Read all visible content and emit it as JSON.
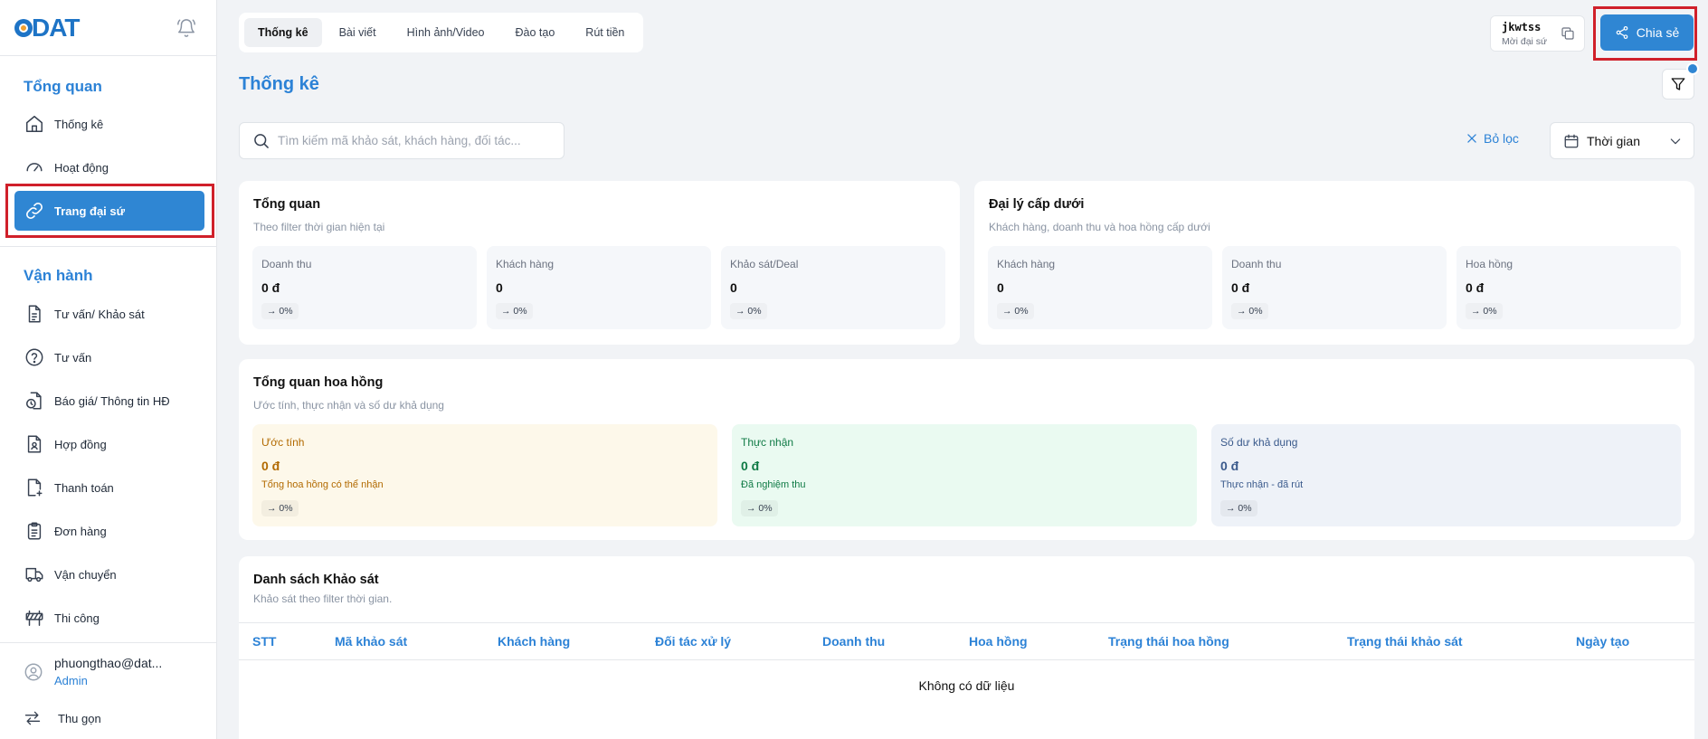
{
  "brand": {
    "logo": "DAT"
  },
  "sidebar": {
    "section_overview": "Tổng quan",
    "overview_items": [
      {
        "label": "Thống kê",
        "icon": "home-icon"
      },
      {
        "label": "Hoạt động",
        "icon": "gauge-icon"
      },
      {
        "label": "Trang đại sứ",
        "icon": "link-icon",
        "active": true
      }
    ],
    "section_operations": "Vận hành",
    "operation_items": [
      {
        "label": "Tư vấn/ Khảo sát",
        "icon": "document-icon"
      },
      {
        "label": "Tư vấn",
        "icon": "help-circle-icon"
      },
      {
        "label": "Báo giá/ Thông tin HĐ",
        "icon": "file-clock-icon"
      },
      {
        "label": "Hợp đồng",
        "icon": "contract-icon"
      },
      {
        "label": "Thanh toán",
        "icon": "file-plus-icon"
      },
      {
        "label": "Đơn hàng",
        "icon": "clipboard-icon"
      },
      {
        "label": "Vận chuyển",
        "icon": "truck-icon"
      },
      {
        "label": "Thi công",
        "icon": "construction-icon"
      }
    ],
    "user": {
      "email": "phuongthao@dat...",
      "role": "Admin"
    },
    "collapse_label": "Thu gọn"
  },
  "tabs": [
    "Thống kê",
    "Bài viết",
    "Hình ảnh/Video",
    "Đào tạo",
    "Rút tiền"
  ],
  "page_title": "Thống kê",
  "invite": {
    "code": "jkwtss",
    "subtitle": "Mời đại sứ"
  },
  "share_label": "Chia sẻ",
  "search": {
    "placeholder": "Tìm kiếm mã khảo sát, khách hàng, đối tác..."
  },
  "clear_filter_label": "Bỏ lọc",
  "time_select": {
    "value": "Thời gian"
  },
  "overview": {
    "title": "Tổng quan",
    "subtitle": "Theo filter thời gian hiện tại",
    "stats": [
      {
        "label": "Doanh thu",
        "value": "0 đ",
        "change": "→ 0%"
      },
      {
        "label": "Khách hàng",
        "value": "0",
        "change": "→ 0%"
      },
      {
        "label": "Khảo sát/Deal",
        "value": "0",
        "change": "→ 0%"
      }
    ]
  },
  "sub_agents": {
    "title": "Đại lý cấp dưới",
    "subtitle": "Khách hàng, doanh thu và hoa hồng cấp dưới",
    "stats": [
      {
        "label": "Khách hàng",
        "value": "0",
        "change": "→ 0%"
      },
      {
        "label": "Doanh thu",
        "value": "0 đ",
        "change": "→ 0%"
      },
      {
        "label": "Hoa hồng",
        "value": "0 đ",
        "change": "→ 0%"
      }
    ]
  },
  "commission": {
    "title": "Tổng quan hoa hồng",
    "subtitle": "Ước tính, thực nhận và số dư khả dụng",
    "stats": [
      {
        "label": "Ước tính",
        "value": "0 đ",
        "note": "Tổng hoa hồng có thể nhận",
        "change": "→ 0%",
        "color": "#b26a00",
        "bg": "#fdf8ea"
      },
      {
        "label": "Thực nhận",
        "value": "0 đ",
        "note": "Đã nghiệm thu",
        "change": "→ 0%",
        "color": "#0f7a45",
        "bg": "#eafaf1"
      },
      {
        "label": "Số dư khả dụng",
        "value": "0 đ",
        "note": "Thực nhận - đã rút",
        "change": "→ 0%",
        "color": "#3a5a8c",
        "bg": "#eef2f8"
      }
    ]
  },
  "survey_list": {
    "title": "Danh sách Khảo sát",
    "subtitle": "Khảo sát theo filter thời gian.",
    "columns": [
      "STT",
      "Mã khảo sát",
      "Khách hàng",
      "Đối tác xử lý",
      "Doanh thu",
      "Hoa hồng",
      "Trạng thái hoa hồng",
      "Trạng thái khảo sát",
      "Ngày tạo"
    ],
    "empty_text": "Không có dữ liệu"
  },
  "colors": {
    "accent": "#2c82d6",
    "button": "#2f86d3",
    "highlight": "#d0202a"
  }
}
